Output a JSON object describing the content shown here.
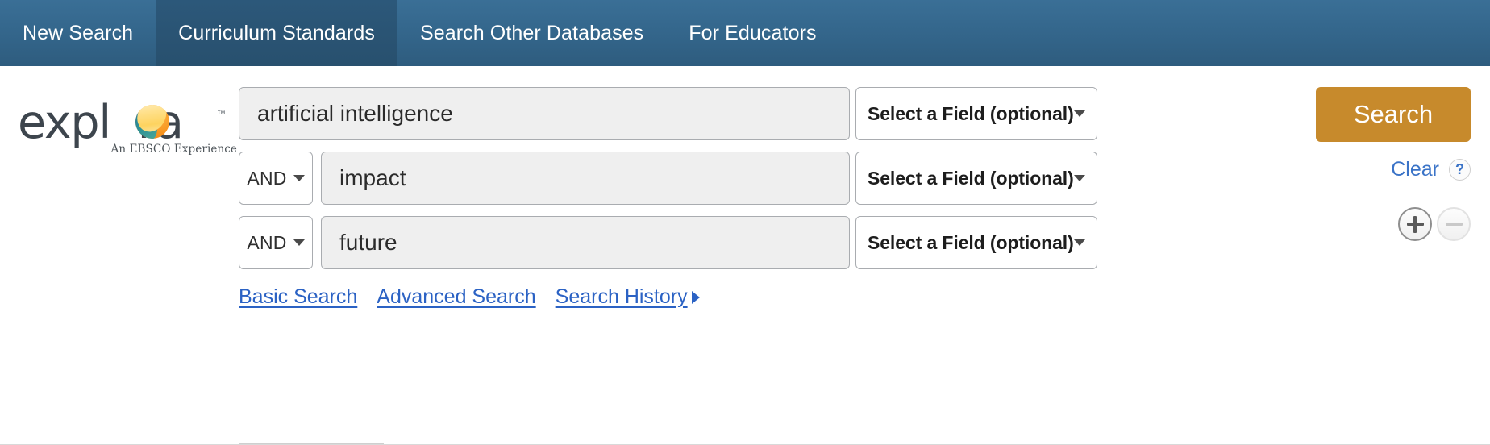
{
  "nav": {
    "items": [
      {
        "label": "New Search",
        "active": false
      },
      {
        "label": "Curriculum Standards",
        "active": true
      },
      {
        "label": "Search Other Databases",
        "active": false
      },
      {
        "label": "For Educators",
        "active": false
      }
    ]
  },
  "logo": {
    "word_part1": "expl",
    "word_part2": "ra",
    "trademark": "™",
    "tagline": "An EBSCO Experience"
  },
  "search": {
    "rows": [
      {
        "boolean": null,
        "term": "artificial intelligence",
        "field": "Select a Field (optional)"
      },
      {
        "boolean": "AND",
        "term": "impact",
        "field": "Select a Field (optional)"
      },
      {
        "boolean": "AND",
        "term": "future",
        "field": "Select a Field (optional)"
      }
    ],
    "search_button": "Search",
    "clear_label": "Clear",
    "help_glyph": "?",
    "add_row_glyph": "+",
    "remove_row_glyph": "−"
  },
  "links": [
    {
      "label": "Basic Search",
      "has_caret": false
    },
    {
      "label": "Advanced Search",
      "has_caret": false
    },
    {
      "label": "Search History",
      "has_caret": true
    }
  ],
  "colors": {
    "nav_background": "#33658a",
    "nav_active": "#2c587a",
    "search_button": "#c78a2c",
    "link_blue": "#2b62c4",
    "input_background": "#efefef"
  }
}
